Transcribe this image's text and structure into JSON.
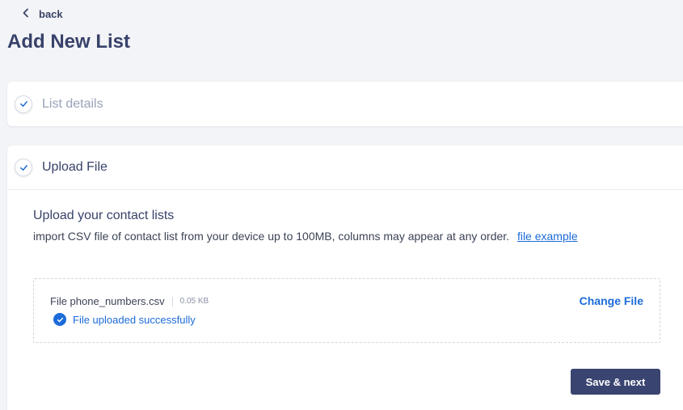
{
  "back": {
    "label": "back"
  },
  "page": {
    "title": "Add New List"
  },
  "steps": {
    "list_details": {
      "label": "List details"
    },
    "upload_file": {
      "label": "Upload File"
    }
  },
  "upload": {
    "title": "Upload your contact lists",
    "description": "import CSV file of contact list from your device up to 100MB, columns may appear at any order.",
    "example_link": "file example",
    "file": {
      "name": "File phone_numbers.csv",
      "size": "0.05 KB",
      "status": "File uploaded successfully",
      "change_label": "Change File"
    },
    "submit_label": "Save & next"
  },
  "colors": {
    "primary": "#3a4470",
    "link": "#1c6bd9",
    "muted": "#9aa2b8"
  }
}
